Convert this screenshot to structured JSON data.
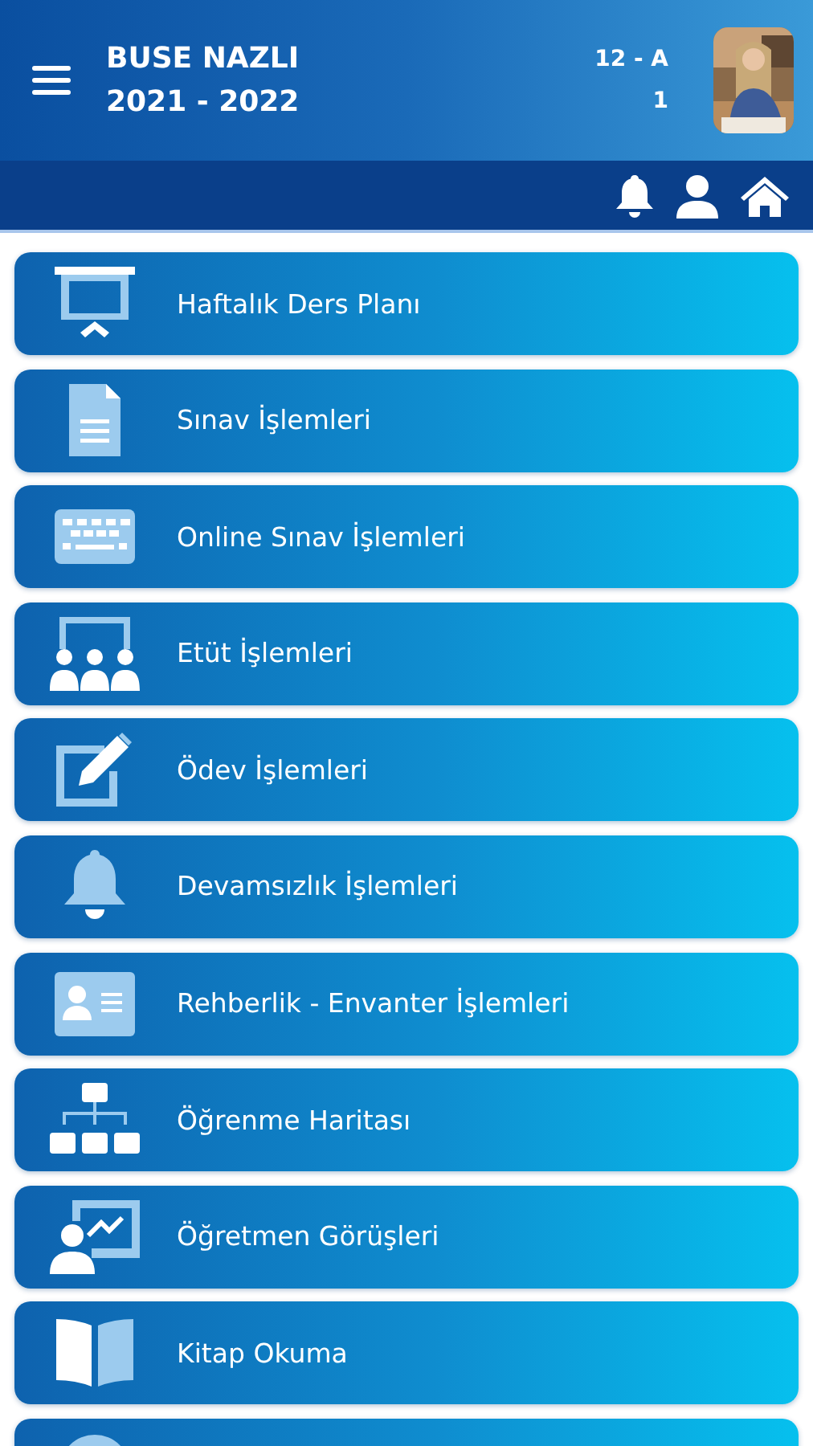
{
  "header": {
    "name": "BUSE NAZLI",
    "year": "2021 - 2022",
    "class": "12 - A",
    "number": "1"
  },
  "menu": [
    {
      "kind": "presentation",
      "label": "Haftalık Ders Planı"
    },
    {
      "kind": "document",
      "label": "Sınav İşlemleri"
    },
    {
      "kind": "keyboard",
      "label": "Online Sınav İşlemleri"
    },
    {
      "kind": "group",
      "label": "Etüt İşlemleri"
    },
    {
      "kind": "edit",
      "label": "Ödev İşlemleri"
    },
    {
      "kind": "bell",
      "label": "Devamsızlık İşlemleri"
    },
    {
      "kind": "idcard",
      "label": "Rehberlik - Envanter İşlemleri"
    },
    {
      "kind": "sitemap",
      "label": "Öğrenme Haritası"
    },
    {
      "kind": "teacher",
      "label": "Öğretmen Görüşleri"
    },
    {
      "kind": "book",
      "label": "Kitap Okuma"
    },
    {
      "kind": "circle"
    }
  ]
}
